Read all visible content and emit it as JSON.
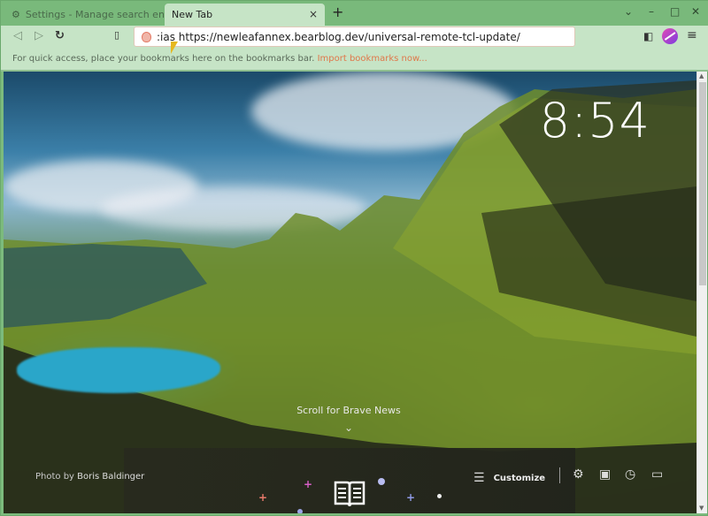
{
  "tabs": [
    {
      "label": "Settings - Manage search engines",
      "icon": "gear-icon",
      "active": false
    },
    {
      "label": "New Tab",
      "active": true,
      "close": "×"
    }
  ],
  "new_tab_symbol": "+",
  "window_controls": {
    "dropdown": "⌄",
    "minimize": "–",
    "maximize": "□",
    "close": "✕"
  },
  "toolbar": {
    "back": "◁",
    "forward": "▷",
    "reload": "↻",
    "bookmark": "🔖",
    "url": ":ias https://newleafannex.bearblog.dev/universal-remote-tcl-update/",
    "sidebar": "◧",
    "menu": "≡"
  },
  "bookmarks_bar": {
    "message": "For quick access, place your bookmarks here on the bookmarks bar.",
    "import_link": "Import bookmarks now..."
  },
  "newtab": {
    "clock": "8:54",
    "scroll_news": "Scroll for Brave News",
    "chevron": "⌄",
    "photo_credit_prefix": "Photo by",
    "photo_credit_author": "Boris Baldinger",
    "customize_label": "Customize",
    "dock_icons": [
      "settings-icon",
      "bookmarks-icon",
      "history-icon",
      "video-call-icon"
    ]
  },
  "colors": {
    "frame": "#7cbb7d",
    "toolbar": "#c6e4c6",
    "import_link": "#e0774a"
  }
}
